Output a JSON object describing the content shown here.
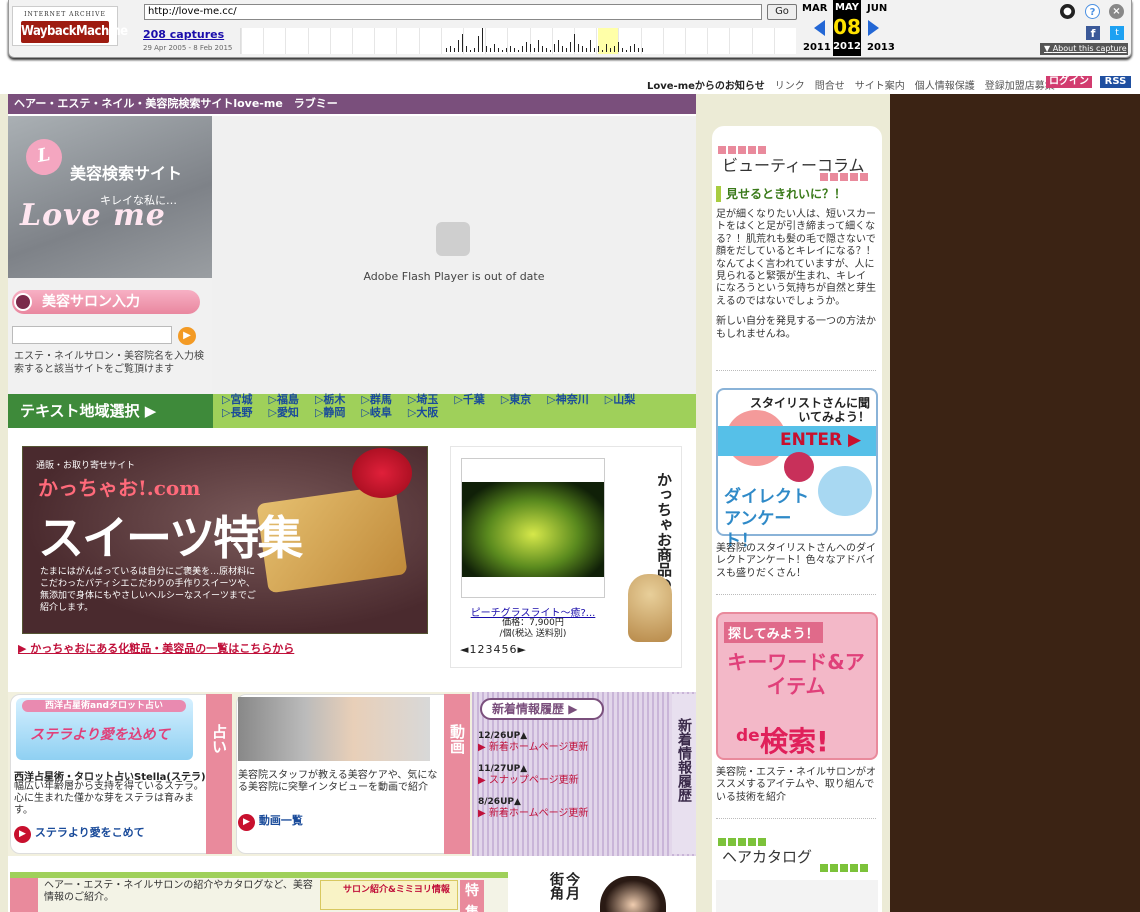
{
  "wayback": {
    "logo_top": "INTERNET ARCHIVE",
    "logo_main": "WaybackMachine",
    "url": "http://love-me.cc/",
    "go": "Go",
    "captures": "208 captures",
    "range": "29 Apr 2005 - 8 Feb 2015",
    "months": {
      "prev": "MAR",
      "cur": "MAY",
      "next": "JUN"
    },
    "day": "08",
    "years": {
      "prev": "2011",
      "cur": "2012",
      "next": "2013"
    },
    "about": "About this capture",
    "colors": {
      "logo": "#9e1b10",
      "arrow": "#2367d5",
      "highlight": "#ffffa8"
    }
  },
  "toplinks": {
    "news": "Love-meからのお知らせ",
    "items": [
      "リンク",
      "問合せ",
      "サイト案内",
      "個人情報保護",
      "登録加盟店募集"
    ],
    "login": "ログイン",
    "rss": "RSS"
  },
  "site": {
    "header": "ヘアー・エステ・ネイル・美容院検索サイトlove-me　ラブミー",
    "colors": {
      "purple": "#7a4f7c",
      "green": "#9fd05a",
      "brown": "#3b2314",
      "pink": "#e98a9c"
    }
  },
  "hero": {
    "letter": "L",
    "title": "美容検索サイト",
    "sub": "キレイな私に…",
    "love": "Love me"
  },
  "flash": {
    "message": "Adobe Flash Player is out of date",
    "icon": "puzzle-icon"
  },
  "salon": {
    "title": "美容サロン入力",
    "desc": "エステ・ネイルサロン・美容院名を入力検索すると該当サイトをご覧頂けます"
  },
  "area": {
    "label": "テキスト地域選択",
    "row1": [
      "宮城",
      "福島",
      "栃木",
      "群馬",
      "埼玉",
      "千葉",
      "東京",
      "神奈川",
      "山梨"
    ],
    "row2": [
      "長野",
      "愛知",
      "静岡",
      "岐阜",
      "大阪"
    ]
  },
  "kacchao": {
    "small": "通販・お取り寄せサイト",
    "logo": "かっちゃお!.com",
    "title": "スイーツ特集",
    "desc": "たまにはがんばっているは自分にご褒美を…原材料にこだわったパティシエこだわりの手作りスイーツや、無添加で身体にもやさしいヘルシーなスイーツまでご紹介します。",
    "link": "かっちゃおにある化粧品・美容品の一覧はこちらから"
  },
  "product": {
    "vertical": "かっちゃお商品の紹介",
    "name": "ピーチグラスライト～癒?...",
    "price": "価格：7,900円",
    "price_note": "/個(税込 送料別)",
    "pager": "◄123456►"
  },
  "uranai": {
    "banner_title": "西洋占星術andタロット占い",
    "banner_sub": "ステラより愛を込めて",
    "tab": "占い",
    "title": "西洋占星術・タロット占いStella(ステラ)",
    "desc": "幅広い年齢層から支持を得ているステラ。心に生まれた僅かな芽をステラは育みます。",
    "link": "ステラより愛をこめて"
  },
  "douga": {
    "tab": "動画",
    "desc": "美容院スタッフが教える美容ケアや、気になる美容院に突撃インタビューを動画で紹介",
    "link": "動画一覧"
  },
  "news": {
    "header": "新着情報履歴",
    "tab": "新着情報履歴",
    "items": [
      {
        "date": "12/26UP▲",
        "text": "新着ホームページ更新"
      },
      {
        "date": "11/27UP▲",
        "text": "スナップページ更新"
      },
      {
        "date": "8/26UP▲",
        "text": "新着ホームページ更新"
      }
    ]
  },
  "row4": {
    "text": "ヘアー・エステ・ネイルサロンの紹介やカタログなど、美容情報のご紹介。",
    "tag": "サロン紹介&ミミヨリ情報",
    "tok": "特集",
    "vertical": "今月 街角"
  },
  "rightcol": {
    "column_title": "ビューティーコラム",
    "column_sub": "見せるときれいに？！",
    "column_body": "足が細くなりたい人は、短いスカートをはくと足が引き締まって細くなる？！肌荒れも髪の毛で隠さないで顔をだしているとキレイになる？！なんてよく言われていますが、人に見られると緊張が生まれ、キレイになろうという気持ちが自然と芽生えるのではないでしょうか。",
    "column_body2": "新しい自分を発見する一つの方法かもしれませんね。",
    "stylist_title": "スタイリストさんに聞いてみよう！",
    "stylist_enter": "ENTER ▶",
    "stylist_direct": "ダイレクトアンケート！",
    "stylist_desc": "美容院のスタイリストさんへのダイレクトアンケート！色々なアドバイスも盛りだくさん！",
    "kw_t1": "探してみよう！",
    "kw_t2": "キーワード&アイテム",
    "kw_de": "de",
    "kw_t3": "検索!",
    "kw_desc": "美容院・エステ・ネイルサロンがオススメするアイテムや、取り組んでいる技術を紹介",
    "hair_title": "ヘアカタログ"
  }
}
